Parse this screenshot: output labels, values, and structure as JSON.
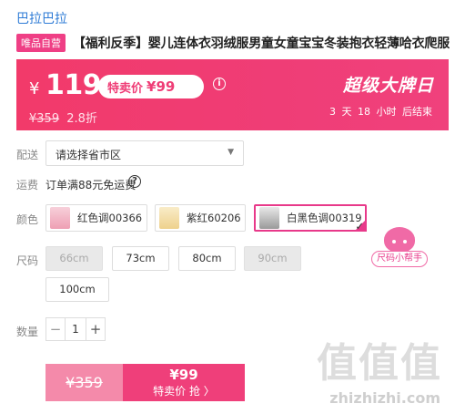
{
  "brand": "巴拉巴拉",
  "tag": "唯品自营",
  "title": "【福利反季】婴儿连体衣羽绒服男童女童宝宝冬装抱衣轻薄哈衣爬服",
  "price": {
    "currency": "¥",
    "value": "119",
    "promo_label": "特卖价",
    "promo_value": "¥99",
    "info_icon": "i",
    "original": "¥359",
    "discount": "2.8折",
    "super_day": "超级大牌日",
    "countdown": "3 天 18 小时 后结束"
  },
  "delivery": {
    "label": "配送",
    "placeholder": "请选择省市区",
    "caret": "▼"
  },
  "shipping": {
    "label": "运费",
    "text": "订单满88元免运费",
    "help_icon": "?"
  },
  "colors": {
    "label": "颜色",
    "options": [
      {
        "name": "红色调00366",
        "selected": false,
        "color": "#f3b6c4"
      },
      {
        "name": "紫红60206",
        "selected": false,
        "color": "#f5e2b0"
      },
      {
        "name": "白黑色调00319",
        "selected": true,
        "color": "#c9c9c9"
      }
    ]
  },
  "sizes": {
    "label": "尺码",
    "options": [
      {
        "name": "66cm",
        "disabled": true
      },
      {
        "name": "73cm",
        "disabled": false
      },
      {
        "name": "80cm",
        "disabled": false
      },
      {
        "name": "90cm",
        "disabled": true
      },
      {
        "name": "100cm",
        "disabled": false
      }
    ],
    "helper": "尺码小帮手"
  },
  "quantity": {
    "label": "数量",
    "minus": "−",
    "value": "1",
    "plus": "+"
  },
  "buy": {
    "original": "¥359",
    "price": "¥99",
    "action": "特卖价 抢 〉"
  },
  "watermark": {
    "text": "值值值",
    "url": "zhizhizhi.com"
  },
  "accent_color": "#ef3d76"
}
